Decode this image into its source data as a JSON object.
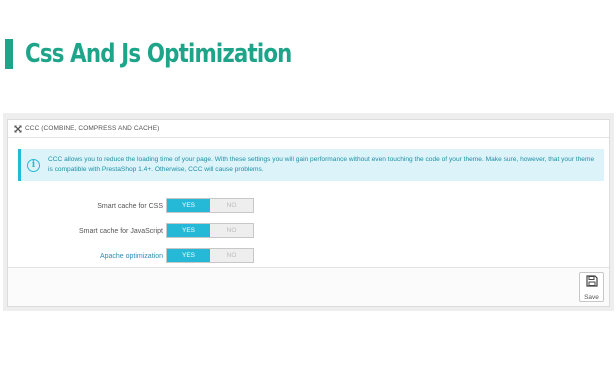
{
  "page": {
    "title": "Css And Js Optimization"
  },
  "panel": {
    "header": "CCC (COMBINE, COMPRESS AND CACHE)",
    "alert": "CCC allows you to reduce the loading time of your page. With these settings you will gain performance without even touching the code of your theme. Make sure, however, that your theme is compatible with PrestaShop 1.4+. Otherwise, CCC will cause problems.",
    "rows": [
      {
        "label": "Smart cache for CSS",
        "yes": "YES",
        "no": "NO",
        "selected": "YES"
      },
      {
        "label": "Smart cache for JavaScript",
        "yes": "YES",
        "no": "NO",
        "selected": "YES"
      },
      {
        "label": "Apache optimization",
        "yes": "YES",
        "no": "NO",
        "selected": "YES"
      }
    ],
    "save_label": "Save"
  },
  "colors": {
    "accent": "#1ea589",
    "switch_on": "#25b9d7",
    "alert_bg": "#dcf4f9",
    "alert_text": "#1f8fa6"
  },
  "icons": {
    "header": "crossed-arrows-icon",
    "alert": "info-icon",
    "save": "floppy-disk-icon"
  }
}
